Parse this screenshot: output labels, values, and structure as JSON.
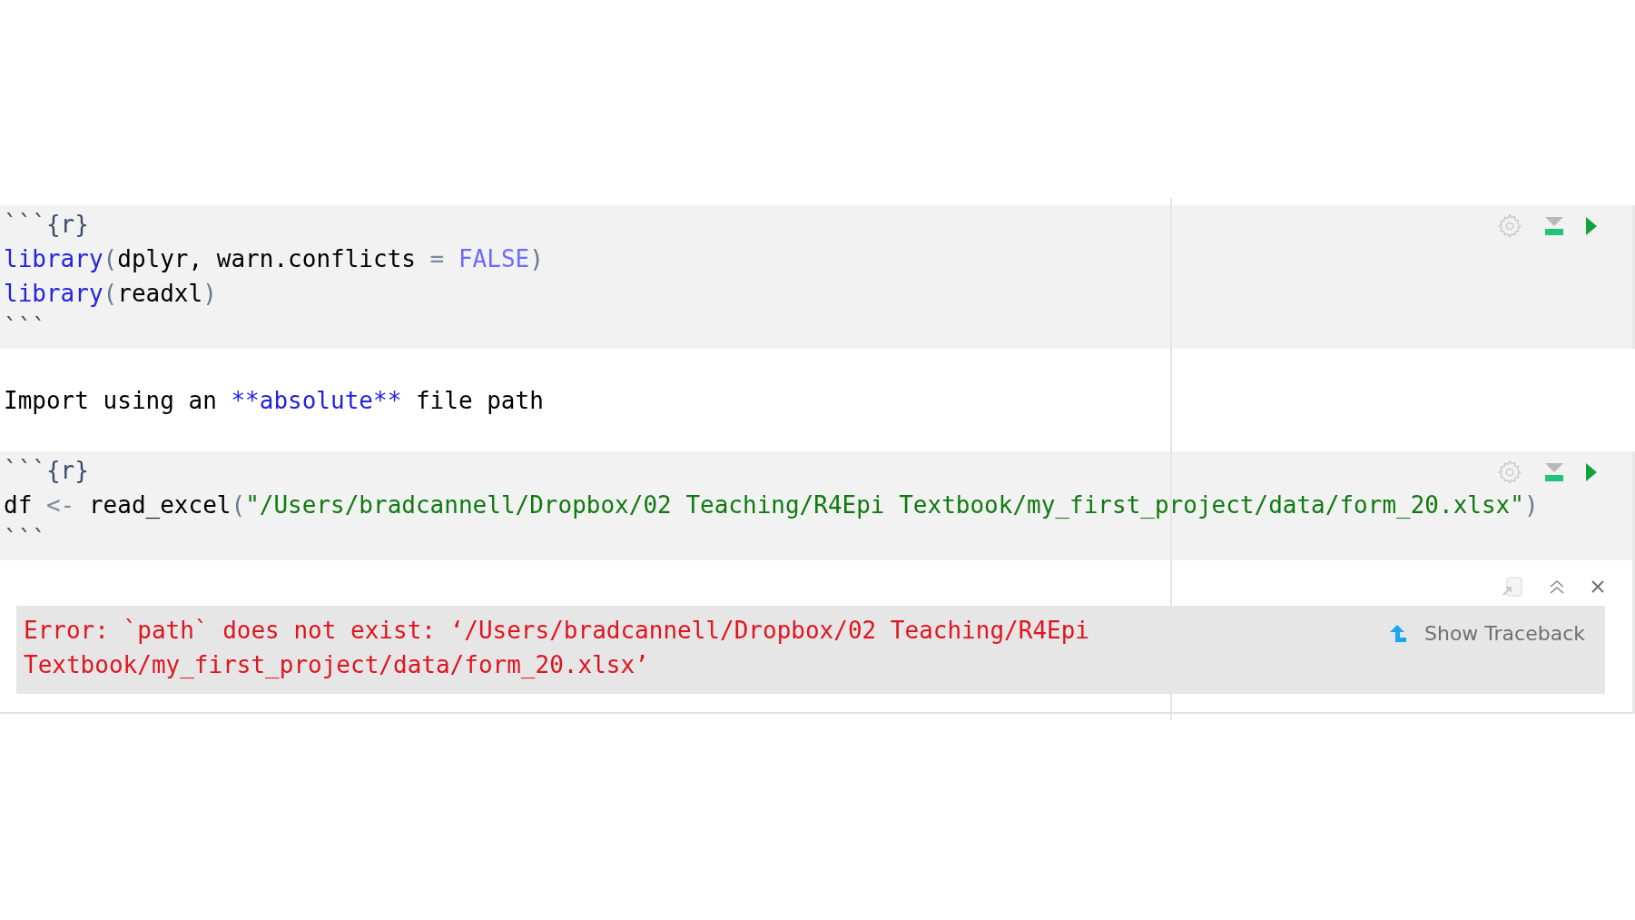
{
  "blocks": [
    {
      "kind": "chunk",
      "lines": [
        [
          {
            "text": "```",
            "kind": "fence"
          },
          {
            "text": "{r}",
            "kind": "fence"
          }
        ],
        [
          {
            "text": "library",
            "kind": "function"
          },
          {
            "text": "(",
            "kind": "punct"
          },
          {
            "text": "dplyr, warn.conflicts ",
            "kind": "plain"
          },
          {
            "text": "=",
            "kind": "operator"
          },
          {
            "text": " FALSE",
            "kind": "constant"
          },
          {
            "text": ")",
            "kind": "punct"
          }
        ],
        [
          {
            "text": "library",
            "kind": "function"
          },
          {
            "text": "(",
            "kind": "punct"
          },
          {
            "text": "readxl",
            "kind": "plain"
          },
          {
            "text": ")",
            "kind": "punct"
          }
        ],
        [
          {
            "text": "```",
            "kind": "fence"
          }
        ]
      ]
    },
    {
      "kind": "markdown",
      "lines": [
        [
          {
            "text": "Import using an ",
            "kind": "plain"
          },
          {
            "text": "**absolute**",
            "kind": "emphasis"
          },
          {
            "text": " file path",
            "kind": "plain"
          }
        ]
      ]
    },
    {
      "kind": "chunk",
      "lines": [
        [
          {
            "text": "```",
            "kind": "fence"
          },
          {
            "text": "{r}",
            "kind": "fence"
          }
        ],
        [
          {
            "text": "df ",
            "kind": "plain"
          },
          {
            "text": "<-",
            "kind": "operator"
          },
          {
            "text": " read_excel",
            "kind": "plain"
          },
          {
            "text": "(",
            "kind": "punct"
          },
          {
            "text": "\"/Users/bradcannell/Dropbox/02 Teaching/R4Epi Textbook/my_first_project/data/form_20.xlsx\"",
            "kind": "string"
          },
          {
            "text": ")",
            "kind": "punct"
          }
        ],
        [
          {
            "text": "```",
            "kind": "fence"
          }
        ]
      ],
      "output": {
        "error": "Error: `path` does not exist: ‘/Users/bradcannell/Dropbox/02 Teaching/R4Epi Textbook/my_first_project/data/form_20.xlsx’",
        "traceback_button": "Show Traceback"
      }
    }
  ]
}
